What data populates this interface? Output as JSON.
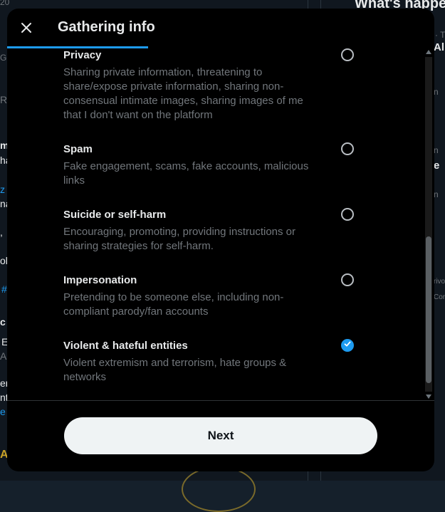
{
  "background": {
    "right_heading": "What's happe",
    "frag_alp": "Alp",
    "frag_e": "e",
    "frag_privacy": "rivo",
    "frag_cor": "Cor",
    "left_a": "A",
    "left_hash": "#",
    "left_z": "z",
    "left_re": "Re",
    "left_m": "m",
    "left_ha": "ha",
    "left_na": "na",
    "left_comma": ",",
    "left_ol": "ol",
    "left_c": "c",
    "left_e": "E",
    "left_au": "Au",
    "left_er": "er",
    "left_nt": "nt",
    "left_e2": "e",
    "left_top_num": "20",
    "left_g": "G",
    "right_n1": "n",
    "right_n2": "n",
    "right_n3": "n",
    "right_dot": "· T"
  },
  "modal": {
    "title": "Gathering info",
    "progress_fraction": 0.33,
    "options": [
      {
        "title": "Privacy",
        "description": "Sharing private information, threatening to share/expose private information, sharing non-consensual intimate images, sharing images of me that I don't want on the platform",
        "selected": false
      },
      {
        "title": "Spam",
        "description": "Fake engagement, scams, fake accounts, malicious links",
        "selected": false
      },
      {
        "title": "Suicide or self-harm",
        "description": "Encouraging, promoting, providing instructions or sharing strategies for self-harm.",
        "selected": false
      },
      {
        "title": "Impersonation",
        "description": "Pretending to be someone else, including non-compliant parody/fan accounts",
        "selected": false
      },
      {
        "title": "Violent & hateful entities",
        "description": "Violent extremism and terrorism, hate groups & networks",
        "selected": true
      }
    ],
    "next_label": "Next"
  },
  "colors": {
    "accent": "#1d9bf0",
    "modal_bg": "#000000",
    "secondary_text": "#71767b",
    "button_bg": "#eff3f4"
  },
  "icons": {
    "close": "close-icon",
    "check": "check-icon"
  }
}
